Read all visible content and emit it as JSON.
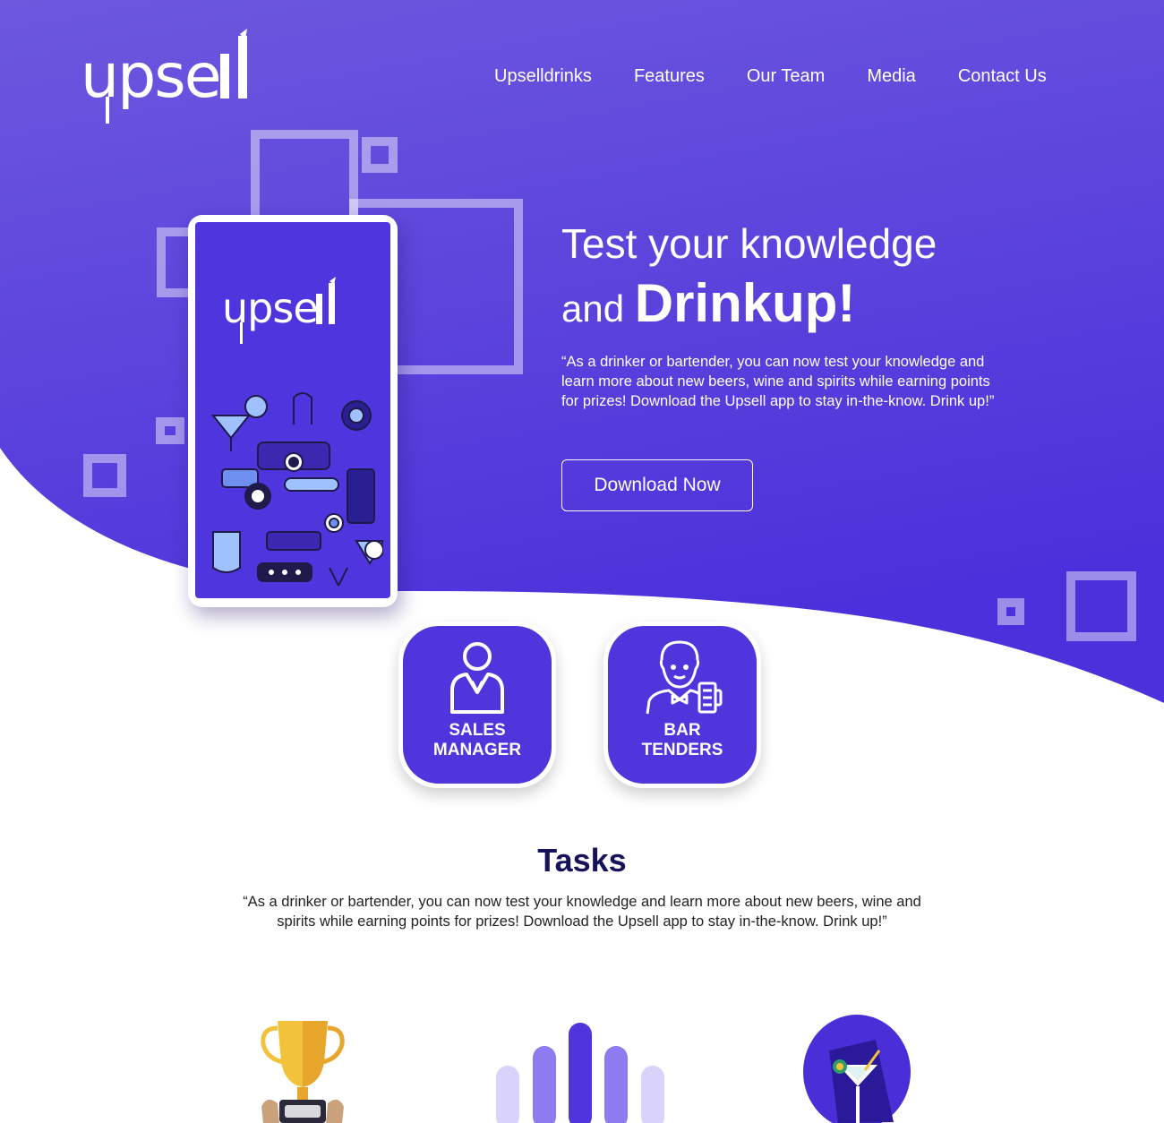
{
  "brand": {
    "logo_text": "upse"
  },
  "nav": {
    "items": [
      {
        "label": "Upselldrinks"
      },
      {
        "label": "Features"
      },
      {
        "label": "Our Team"
      },
      {
        "label": "Media"
      },
      {
        "label": "Contact Us"
      }
    ]
  },
  "hero": {
    "title_line1": "Test your knowledge",
    "title_line2_prefix": "and ",
    "title_line2_bold": "Drinkup!",
    "description": "“As a drinker or bartender, you can now test your knowledge and learn more about new beers, wine and spirits while earning points for prizes! Download the Upsell app to stay in-the-know. Drink up!”",
    "cta_label": "Download Now"
  },
  "roles": [
    {
      "line1": "SALES",
      "line2": "MANAGER",
      "icon": "manager-icon"
    },
    {
      "line1": "BAR",
      "line2": "TENDERS",
      "icon": "bartender-icon"
    }
  ],
  "tasks": {
    "title": "Tasks",
    "description": "“As a drinker or bartender, you can now test your knowledge and learn more about new beers, wine and spirits while earning points for prizes! Download the Upsell app to stay in-the-know. Drink up!”"
  },
  "features": [
    {
      "icon": "trophy-icon"
    },
    {
      "icon": "bar-chart-icon"
    },
    {
      "icon": "cocktail-icon"
    }
  ],
  "colors": {
    "primary": "#5135dc",
    "hero_gradient_top": "#6b56de",
    "hero_gradient_bottom": "#4f33dc",
    "heading_dark": "#16135a",
    "white": "#ffffff"
  }
}
